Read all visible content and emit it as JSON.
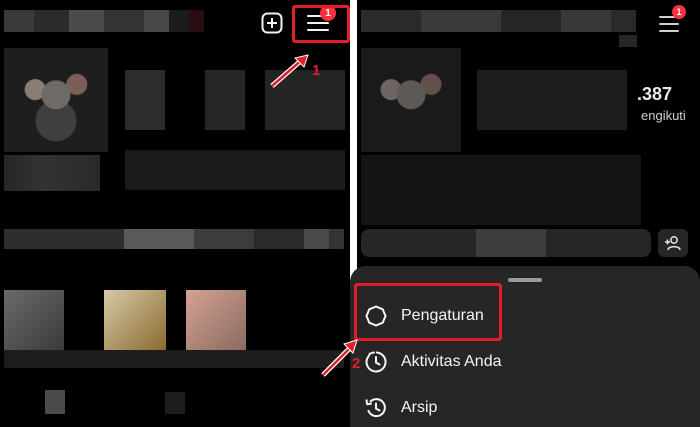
{
  "annotations": {
    "step1": "1",
    "step2": "2"
  },
  "header": {
    "notification_badge": "1",
    "right_badge": "1"
  },
  "profile": {
    "followers_count": ".387",
    "followers_label": "engikuti"
  },
  "menu": {
    "items": [
      {
        "label": "Pengaturan",
        "icon": "settings-icon"
      },
      {
        "label": "Aktivitas Anda",
        "icon": "activity-icon"
      },
      {
        "label": "Arsip",
        "icon": "archive-icon"
      }
    ]
  },
  "colors": {
    "annotation": "#e01f2b",
    "badge": "#ff3040",
    "sheet": "#262626"
  }
}
